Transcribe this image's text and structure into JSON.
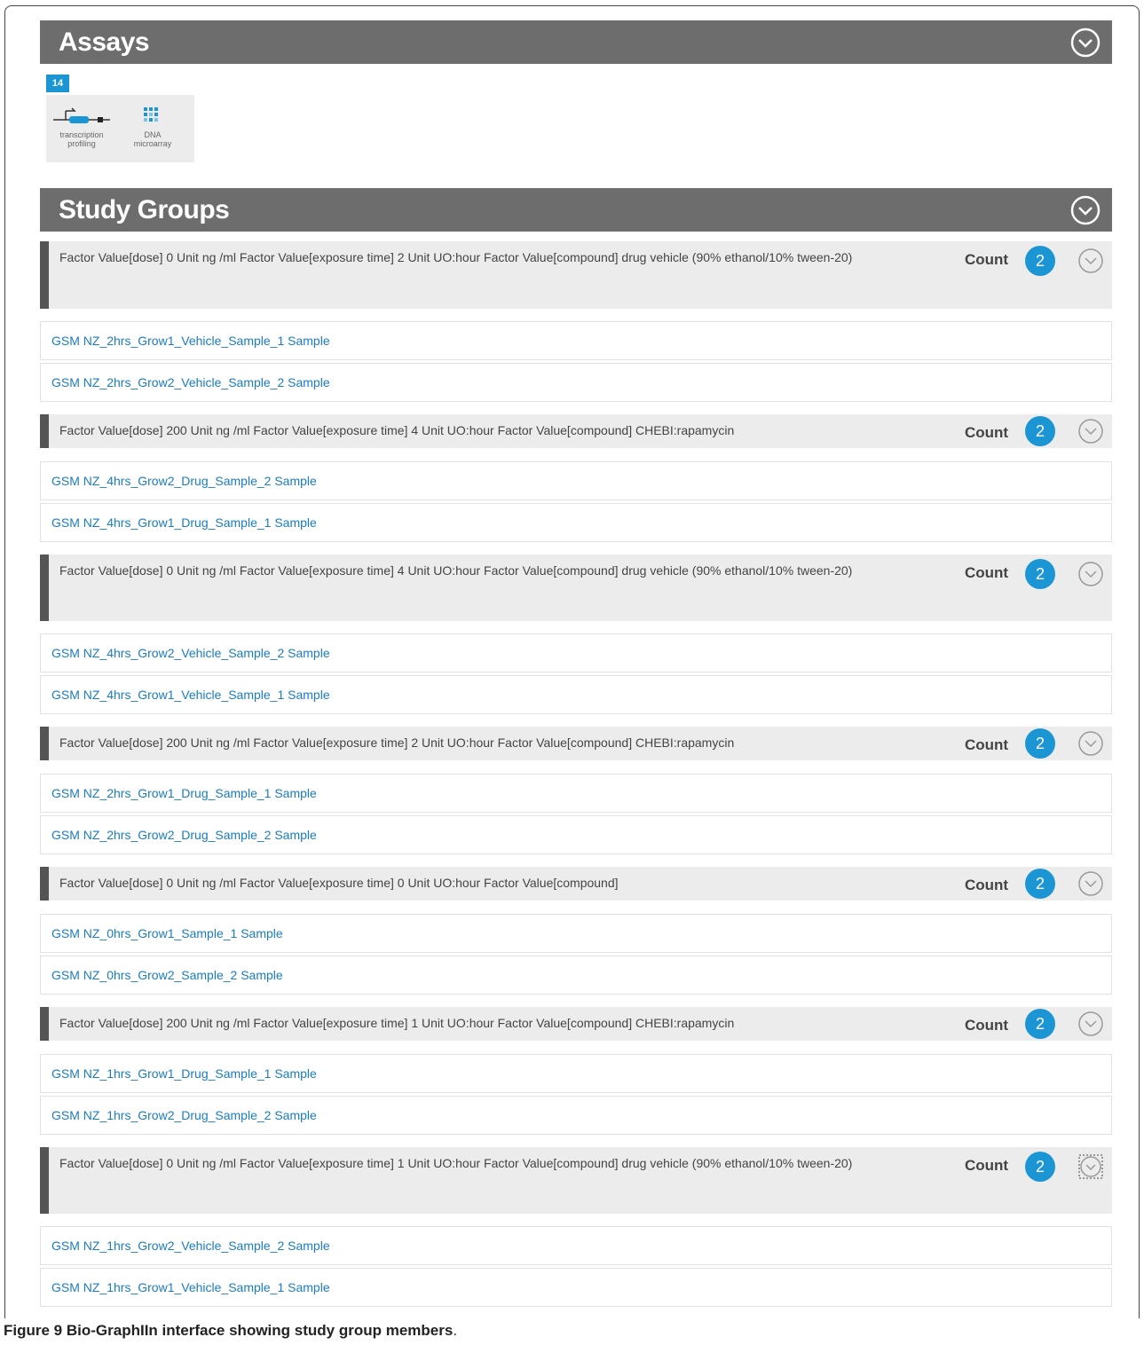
{
  "assays": {
    "title": "Assays",
    "count": "14",
    "items": [
      {
        "label_line1": "transcription",
        "label_line2": "profiling",
        "icon": "transcription-profiling-icon"
      },
      {
        "label_line1": "DNA",
        "label_line2": "microarray",
        "icon": "dna-microarray-icon"
      }
    ]
  },
  "study_groups": {
    "title": "Study Groups",
    "count_label": "Count",
    "groups": [
      {
        "desc": "Factor Value[dose] 0 Unit ng /ml Factor Value[exposure time] 2 Unit UO:hour Factor Value[compound] drug vehicle (90% ethanol/10% tween-20)",
        "count": "2",
        "members": [
          "GSM NZ_2hrs_Grow1_Vehicle_Sample_1 Sample",
          "GSM NZ_2hrs_Grow2_Vehicle_Sample_2 Sample"
        ]
      },
      {
        "desc": "Factor Value[dose] 200 Unit ng /ml Factor Value[exposure time] 4 Unit UO:hour Factor Value[compound] CHEBI:rapamycin",
        "count": "2",
        "members": [
          "GSM NZ_4hrs_Grow2_Drug_Sample_2 Sample",
          "GSM NZ_4hrs_Grow1_Drug_Sample_1 Sample"
        ]
      },
      {
        "desc": "Factor Value[dose] 0 Unit ng /ml Factor Value[exposure time] 4 Unit UO:hour Factor Value[compound] drug vehicle (90% ethanol/10% tween-20)",
        "count": "2",
        "members": [
          "GSM NZ_4hrs_Grow2_Vehicle_Sample_2 Sample",
          "GSM NZ_4hrs_Grow1_Vehicle_Sample_1 Sample"
        ]
      },
      {
        "desc": "Factor Value[dose] 200 Unit ng /ml Factor Value[exposure time] 2 Unit UO:hour Factor Value[compound] CHEBI:rapamycin",
        "count": "2",
        "members": [
          "GSM NZ_2hrs_Grow1_Drug_Sample_1 Sample",
          "GSM NZ_2hrs_Grow2_Drug_Sample_2 Sample"
        ]
      },
      {
        "desc": "Factor Value[dose] 0 Unit ng /ml Factor Value[exposure time] 0 Unit UO:hour Factor Value[compound]",
        "count": "2",
        "members": [
          "GSM NZ_0hrs_Grow1_Sample_1 Sample",
          "GSM NZ_0hrs_Grow2_Sample_2 Sample"
        ]
      },
      {
        "desc": "Factor Value[dose] 200 Unit ng /ml Factor Value[exposure time] 1 Unit UO:hour Factor Value[compound] CHEBI:rapamycin",
        "count": "2",
        "members": [
          "GSM NZ_1hrs_Grow1_Drug_Sample_1 Sample",
          "GSM NZ_1hrs_Grow2_Drug_Sample_2 Sample"
        ]
      },
      {
        "desc": "Factor Value[dose] 0 Unit ng /ml Factor Value[exposure time] 1 Unit UO:hour Factor Value[compound] drug vehicle (90% ethanol/10% tween-20)",
        "count": "2",
        "members": [
          "GSM NZ_1hrs_Grow2_Vehicle_Sample_2 Sample",
          "GSM NZ_1hrs_Grow1_Vehicle_Sample_1 Sample"
        ]
      }
    ]
  },
  "caption": {
    "label": "Figure 9",
    "text": "Bio-GraphIIn interface showing study group members",
    "suffix": "."
  },
  "colors": {
    "section_bar": "#6d6d6d",
    "accent_blue": "#1c95d4",
    "link_blue": "#1a7cc2",
    "group_bg": "#ececec"
  }
}
